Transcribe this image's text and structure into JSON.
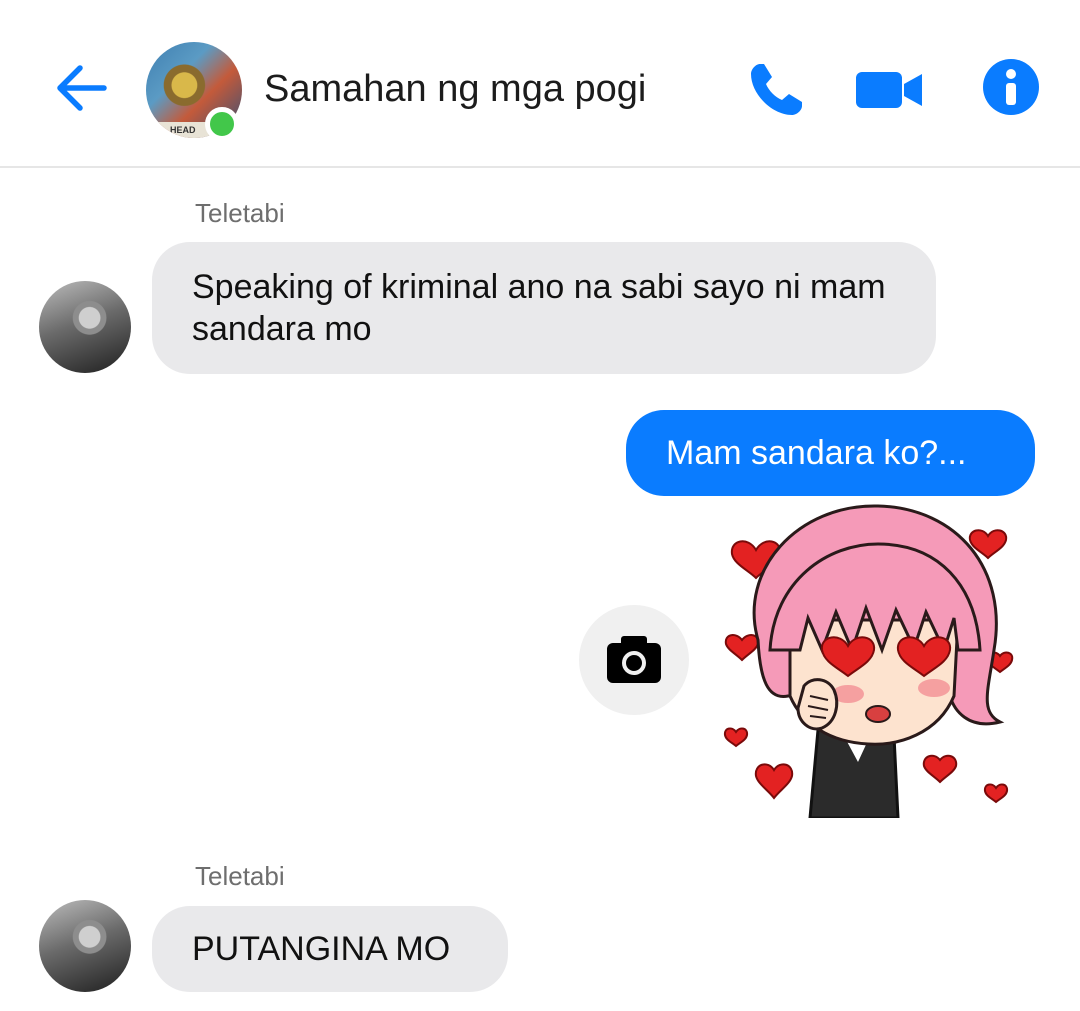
{
  "header": {
    "title": "Samahan ng mga pogi",
    "avatar_caption": "HEAD",
    "icons": [
      "back-arrow-icon",
      "phone-icon",
      "video-camera-icon",
      "info-icon"
    ],
    "accent_color": "#0a7cff",
    "online_color": "#42c74a"
  },
  "messages": [
    {
      "sender": "Teletabi",
      "direction": "incoming",
      "text": "Speaking of kriminal ano na sabi sayo ni mam sandara mo"
    },
    {
      "direction": "outgoing",
      "text": "Mam sandara ko?..."
    },
    {
      "direction": "outgoing",
      "type": "sticker",
      "sticker": "pink-haired girl with heart eyes"
    },
    {
      "sender": "Teletabi",
      "direction": "incoming",
      "text": "PUTANGINA MO"
    }
  ],
  "colors": {
    "incoming_bubble": "#e9e9eb",
    "outgoing_bubble": "#0a7cff"
  }
}
